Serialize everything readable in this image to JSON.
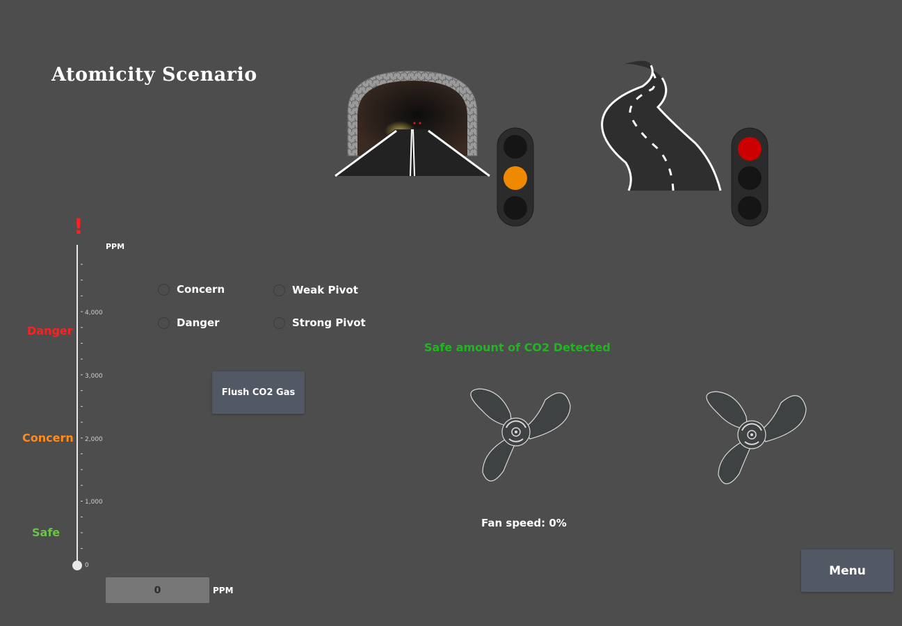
{
  "title": "Atomicity Scenario",
  "gauge": {
    "unit": "PPM",
    "ticks": [
      "4,000",
      "3,000",
      "2,000",
      "1,000",
      "0"
    ],
    "labels": {
      "danger": "Danger",
      "concern": "Concern",
      "safe": "Safe"
    },
    "alert_icon": "exclamation-icon",
    "value": 0
  },
  "options": {
    "concern": "Concern",
    "danger": "Danger",
    "weak_pivot": "Weak Pivot",
    "strong_pivot": "Strong Pivot"
  },
  "flush_button": "Flush CO2 Gas",
  "ppm_input": {
    "value": "0",
    "unit": "PPM"
  },
  "status_text": "Safe amount of CO2 Detected",
  "fan_speed": "Fan speed: 0%",
  "menu_button": "Menu",
  "traffic_lights": {
    "tunnel": "amber",
    "road": "red"
  },
  "colors": {
    "danger": "#ff2020",
    "concern": "#ff8c1a",
    "safe": "#6cc24a",
    "status_safe": "#22b522",
    "light_red": "#cc0000",
    "light_amber": "#ef8a00"
  }
}
